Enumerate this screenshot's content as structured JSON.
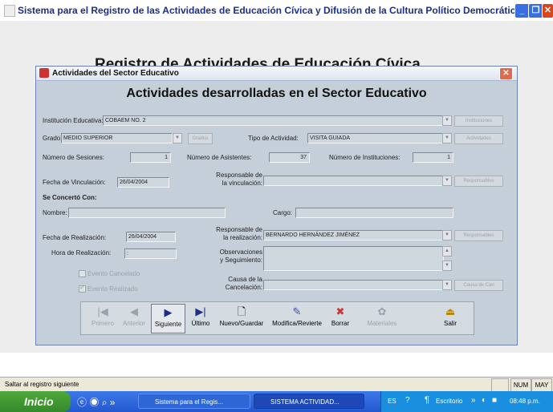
{
  "window": {
    "title": "Sistema para el Registro de las Actividades de Educación Cívica y Difusión de la Cultura Político Democrática",
    "background_title": "Registro de Actividades de Educación Cívica"
  },
  "dialog": {
    "title": "Actividades del Sector Educativo",
    "heading": "Actividades desarrolladas en el Sector Educativo",
    "institucion": {
      "label": "Institución Educativa:",
      "value": "COBAEM NO. 2",
      "button": "Instituciones"
    },
    "grado": {
      "label": "Grado:",
      "value": "MEDIO SUPERIOR",
      "button": "Grados"
    },
    "tipo": {
      "label": "Tipo de Actividad:",
      "value": "VISITA GUIADA",
      "button": "Actividades"
    },
    "sesiones": {
      "label": "Número de Sesiones:",
      "value": "1"
    },
    "asistentes": {
      "label": "Número de Asistentes:",
      "value": "37"
    },
    "instituciones_num": {
      "label": "Número de Instituciones:",
      "value": "1"
    },
    "fecha_vinculacion": {
      "label": "Fecha de Vinculación:",
      "value": "26/04/2004"
    },
    "resp_vinculacion": {
      "label1": "Responsable de",
      "label2": "la vinculación:",
      "value": "",
      "button": "Responsables"
    },
    "concerto": {
      "label": "Se Concertó Con:"
    },
    "nombre": {
      "label": "Nombre:",
      "value": ""
    },
    "cargo": {
      "label": "Cargo:",
      "value": ""
    },
    "fecha_realizacion": {
      "label": "Fecha de Realización:",
      "value": "26/04/2004"
    },
    "resp_realizacion": {
      "label1": "Responsable de",
      "label2": "la realización:",
      "value": "BERNARDO HERNÁNDEZ JIMÉNEZ",
      "button": "Responsables"
    },
    "hora": {
      "label": "Hora de Realización:",
      "value": ":"
    },
    "observaciones": {
      "label1": "Observaciones",
      "label2": "y Seguimiento:",
      "value": ""
    },
    "evento_cancelado": "Evento Cancelado",
    "evento_realizado": "Evento Realizado",
    "causa": {
      "label1": "Causa de la",
      "label2": "Cancelación:",
      "value": "",
      "button": "Causa de Can"
    },
    "toolbar": [
      {
        "label": "Primero",
        "icon": "first-icon"
      },
      {
        "label": "Anterior",
        "icon": "previous-icon"
      },
      {
        "label": "Siguiente",
        "icon": "next-icon"
      },
      {
        "label": "Último",
        "icon": "last-icon"
      },
      {
        "label": "Nuevo/Guardar",
        "icon": "new-document-icon"
      },
      {
        "label": "Modifica/Revierte",
        "icon": "edit-icon"
      },
      {
        "label": "Borrar",
        "icon": "delete-icon"
      },
      {
        "label": "Materiales",
        "icon": "materials-icon"
      },
      {
        "label": "Salir",
        "icon": "exit-icon"
      }
    ]
  },
  "status": {
    "text": "Saltar al registro siguiente",
    "num": "NUM",
    "may": "MAY"
  },
  "taskbar": {
    "start": "Inicio",
    "more": "»",
    "tasks": [
      "Sistema para el Regis...",
      "SISTEMA ACTIVIDAD..."
    ],
    "lang": "ES",
    "desktop": "Escritorio",
    "more2": "»",
    "clock": "08:48 p.m."
  }
}
